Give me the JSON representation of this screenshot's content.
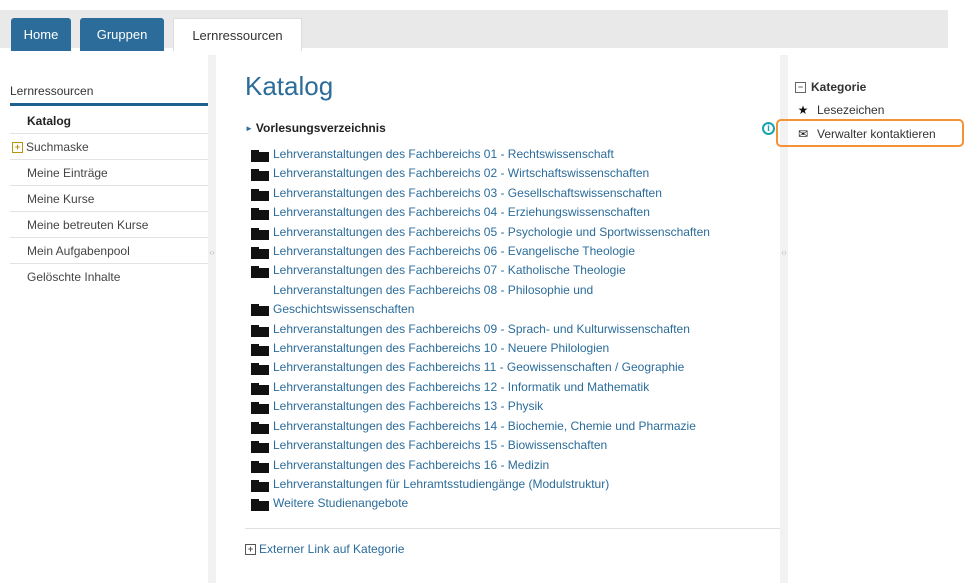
{
  "tabs": [
    {
      "label": "Home"
    },
    {
      "label": "Gruppen"
    },
    {
      "label": "Lernressourcen"
    }
  ],
  "sidebar": {
    "heading": "Lernressourcen",
    "items": [
      {
        "label": "Katalog"
      },
      {
        "label": "Suchmaske"
      },
      {
        "label": "Meine Einträge"
      },
      {
        "label": "Meine Kurse"
      },
      {
        "label": "Meine betreuten Kurse"
      },
      {
        "label": "Mein Aufgabenpool"
      },
      {
        "label": "Gelöschte Inhalte"
      }
    ]
  },
  "main": {
    "title": "Katalog",
    "section": "Vorlesungsverzeichnis",
    "entries": [
      "Lehrveranstaltungen des Fachbereichs 01 - Rechtswissenschaft",
      "Lehrveranstaltungen des Fachbereichs 02 - Wirtschaftswissenschaften",
      "Lehrveranstaltungen des Fachbereichs 03 - Gesellschaftswissenschaften",
      "Lehrveranstaltungen des Fachbereichs 04 - Erziehungswissenschaften",
      "Lehrveranstaltungen des Fachbereichs 05 - Psychologie und Sportwissenschaften",
      "Lehrveranstaltungen des Fachbereichs 06 - Evangelische Theologie",
      "Lehrveranstaltungen des Fachbereichs 07 - Katholische Theologie",
      "Lehrveranstaltungen des Fachbereichs 08 - Philosophie und Geschichtswissenschaften",
      "Lehrveranstaltungen des Fachbereichs 09 - Sprach- und Kulturwissenschaften",
      "Lehrveranstaltungen des Fachbereichs 10 - Neuere Philologien",
      "Lehrveranstaltungen des Fachbereichs 11 - Geowissenschaften / Geographie",
      "Lehrveranstaltungen des Fachbereichs 12 - Informatik und Mathematik",
      "Lehrveranstaltungen des Fachbereichs 13 - Physik",
      "Lehrveranstaltungen des Fachbereichs 14 - Biochemie, Chemie und Pharmazie",
      "Lehrveranstaltungen des Fachbereichs 15 - Biowissenschaften",
      "Lehrveranstaltungen des Fachbereichs 16 - Medizin",
      "Lehrveranstaltungen für Lehramtsstudiengänge (Modulstruktur)",
      "Weitere Studienangebote"
    ],
    "ext_link": "Externer Link auf Kategorie",
    "info_icon": "i"
  },
  "right": {
    "category": "Kategorie",
    "bookmark": "Lesezeichen",
    "contact": "Verwalter kontaktieren",
    "highlight_color": "#f39237"
  },
  "colors": {
    "accent": "#2b6c9a",
    "tab_bg": "#e9e9e9"
  }
}
